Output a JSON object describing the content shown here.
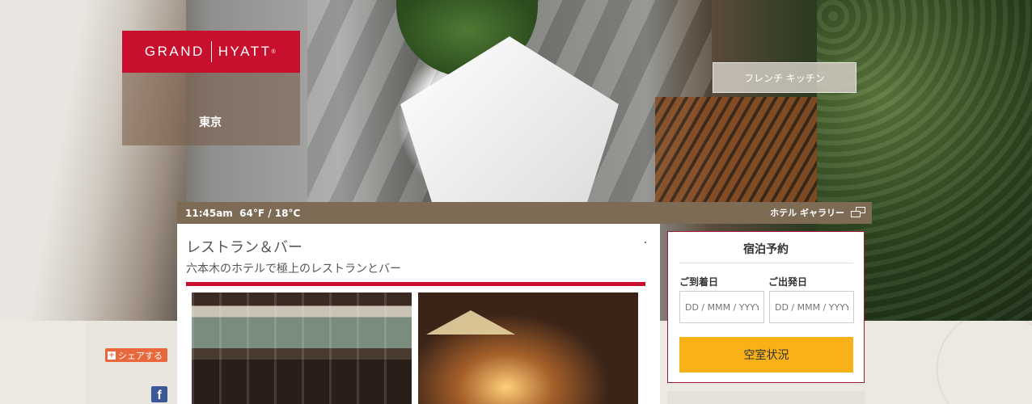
{
  "brand": {
    "logo_left": "GRAND",
    "logo_right": "HYATT",
    "logo_mark": "®",
    "city": "東京",
    "logo_color": "#c8102e"
  },
  "hero": {
    "restaurant_badge": "フレンチ キッチン"
  },
  "info_bar": {
    "time_weather": "11:45am  64°F / 18°C",
    "gallery_link": "ホテル ギャラリー",
    "gallery_icon": "gallery-windows-icon"
  },
  "main": {
    "title": "レストラン＆バー",
    "subtitle": "六本木のホテルで極上のレストランとバー",
    "accent_color": "#c8102e"
  },
  "booking": {
    "title": "宿泊予約",
    "check_in_label": "ご到着日",
    "check_out_label": "ご出発日",
    "check_in_placeholder": "DD / MMM / YYYY",
    "check_out_placeholder": "DD / MMM / YYYY",
    "availability_button": "空室状況",
    "button_color": "#f8b217"
  },
  "share": {
    "plus": "+",
    "label": "シェアする",
    "facebook_letter": "f",
    "facebook_color": "#3b5998"
  }
}
